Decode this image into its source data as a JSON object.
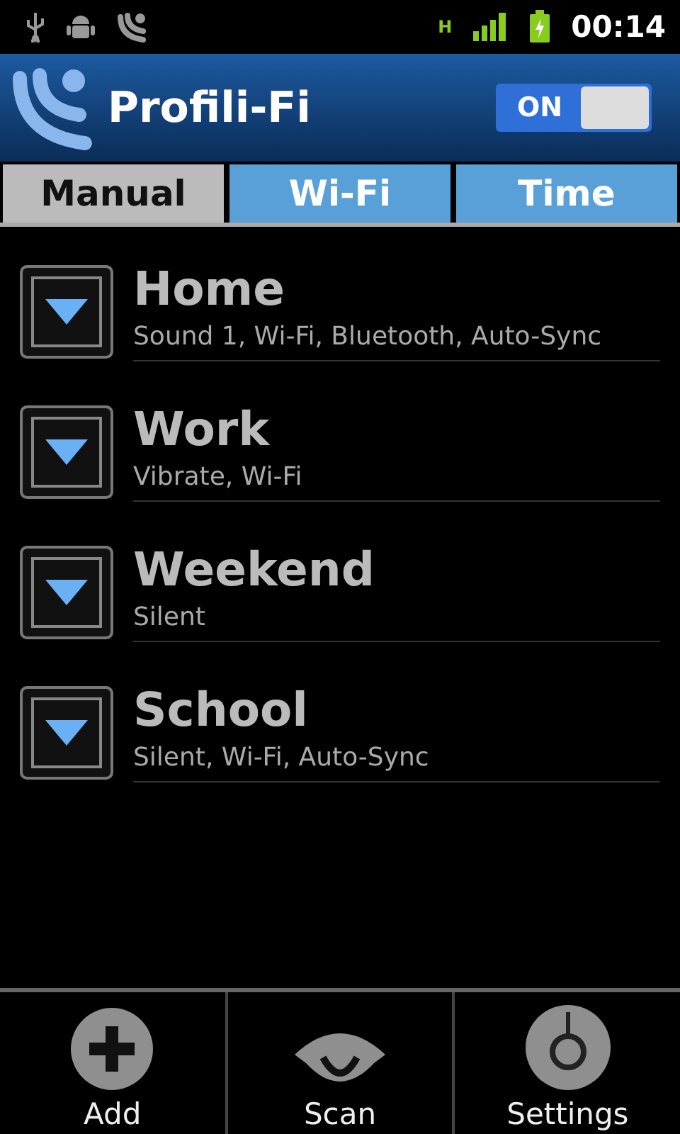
{
  "status_bar": {
    "time": "00:14",
    "network": "H"
  },
  "header": {
    "title": "Profili-Fi",
    "toggle": {
      "label": "ON",
      "on": true
    }
  },
  "tabs": [
    {
      "label": "Manual",
      "selected": true
    },
    {
      "label": "Wi-Fi",
      "selected": false
    },
    {
      "label": "Time",
      "selected": false
    }
  ],
  "profiles": [
    {
      "name": "Home",
      "details": "Sound 1, Wi-Fi, Bluetooth, Auto-Sync"
    },
    {
      "name": "Work",
      "details": "Vibrate, Wi-Fi"
    },
    {
      "name": "Weekend",
      "details": "Silent"
    },
    {
      "name": "School",
      "details": "Silent, Wi-Fi, Auto-Sync"
    }
  ],
  "toolbar": [
    {
      "kind": "add",
      "label": "Add"
    },
    {
      "kind": "scan",
      "label": "Scan"
    },
    {
      "kind": "settings",
      "label": "Settings"
    }
  ]
}
